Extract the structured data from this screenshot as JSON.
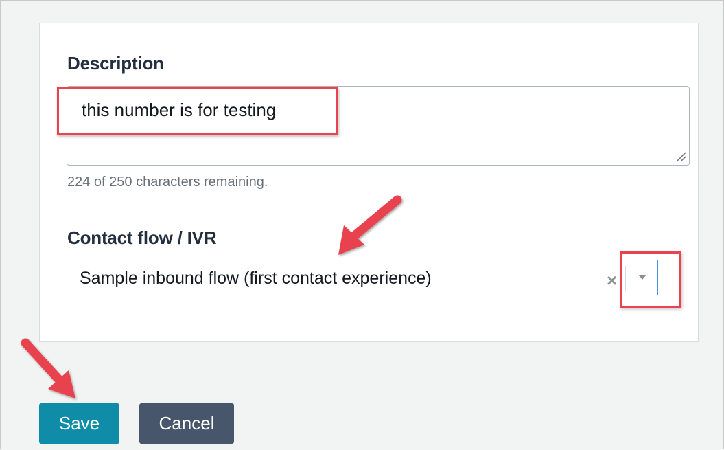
{
  "form": {
    "description": {
      "label": "Description",
      "value": "this number is for testing",
      "char_count": "224 of 250 characters remaining."
    },
    "contact_flow": {
      "label": "Contact flow / IVR",
      "selected": "Sample inbound flow (first contact experience)",
      "clear_glyph": "×"
    }
  },
  "actions": {
    "save_label": "Save",
    "cancel_label": "Cancel"
  },
  "colors": {
    "highlight": "#e8434f",
    "save": "#0f8ca8",
    "cancel": "#47566b",
    "select_border": "#4a90e2"
  },
  "icons": {
    "clear": "close-icon",
    "dropdown": "chevron-down-icon",
    "resize": "resize-handle-icon",
    "annotation": "red-arrow-icon"
  }
}
